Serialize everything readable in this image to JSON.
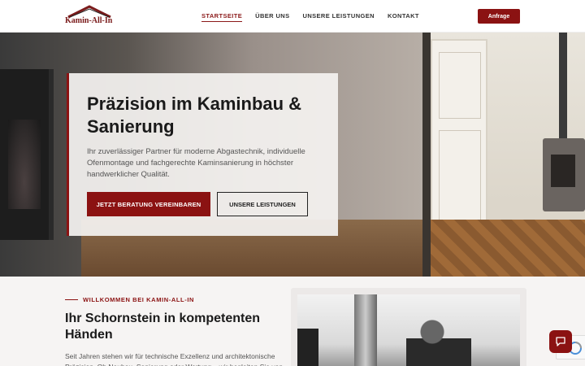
{
  "header": {
    "logo_text": "Kamin-All-In",
    "nav": [
      "STARTSEITE",
      "ÜBER UNS",
      "UNSERE LEISTUNGEN",
      "KONTAKT"
    ],
    "cta_label": "Anfrage"
  },
  "hero": {
    "title": "Präzision im Kaminbau & Sanierung",
    "text": "Ihr zuverlässiger Partner für moderne Abgastechnik, individuelle Ofenmontage und fachgerechte Kaminsanierung in höchster handwerklicher Qualität.",
    "primary_button": "JETZT BERATUNG VEREINBAREN",
    "secondary_button": "UNSERE LEISTUNGEN"
  },
  "welcome": {
    "kicker": "WILLKOMMEN BEI KAMIN-ALL-IN",
    "title": "Ihr Schornstein in kompetenten Händen",
    "text": "Seit Jahren stehen wir für technische Exzellenz und architektonische Präzision. Ob Neubau, Sanierung oder Wartung – wir begleiten Sie von"
  },
  "colors": {
    "accent": "#8b1212"
  },
  "icons": {
    "chat": "chat-bubble-icon",
    "logo": "house-roof-icon"
  }
}
